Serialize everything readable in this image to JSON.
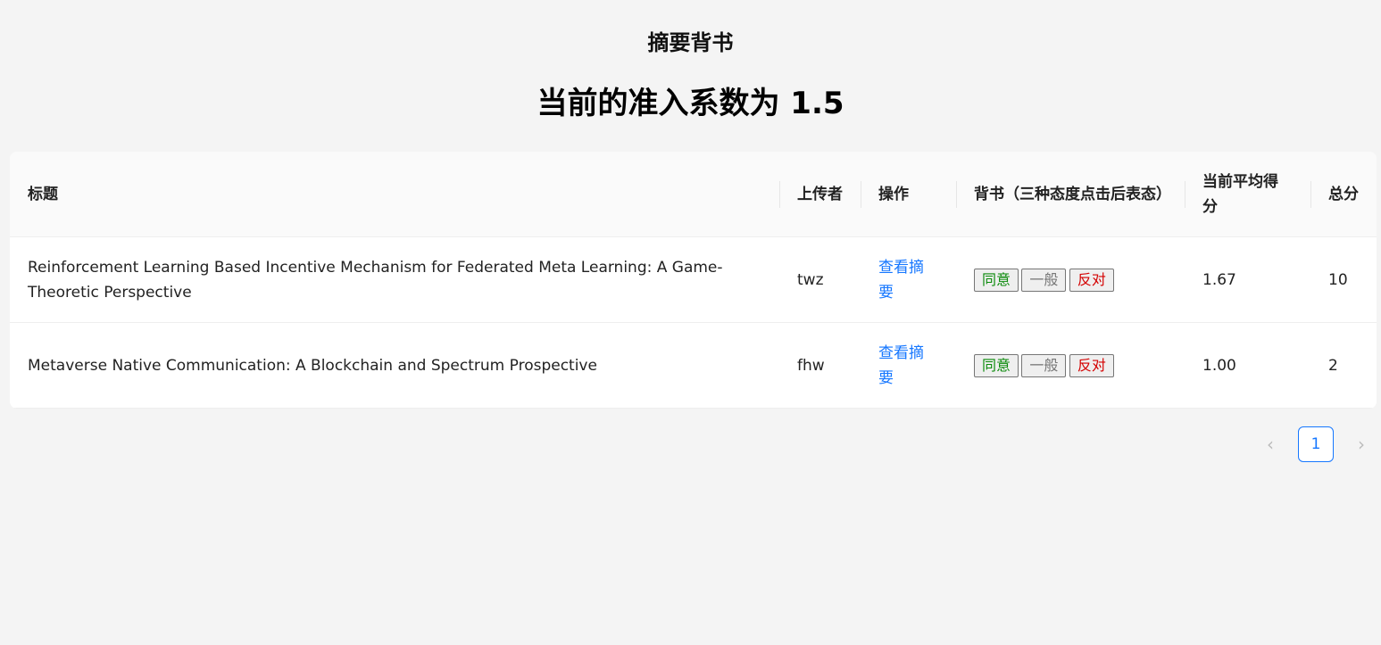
{
  "header": {
    "subtitle": "摘要背书",
    "title": "当前的准入系数为 1.5"
  },
  "table": {
    "columns": [
      "标题",
      "上传者",
      "操作",
      "背书（三种态度点击后表态）",
      "当前平均得分",
      "总分"
    ],
    "rows": [
      {
        "title": "Reinforcement Learning Based Incentive Mechanism for Federated Meta Learning: A Game-Theoretic Perspective",
        "uploader": "twz",
        "action": "查看摘要",
        "agree": "同意",
        "neutral": "一般",
        "oppose": "反对",
        "avg_score": "1.67",
        "total": "10"
      },
      {
        "title": "Metaverse Native Communication: A Blockchain and Spectrum Prospective",
        "uploader": "fhw",
        "action": "查看摘要",
        "agree": "同意",
        "neutral": "一般",
        "oppose": "反对",
        "avg_score": "1.00",
        "total": "2"
      }
    ]
  },
  "pagination": {
    "prev_icon": "‹",
    "current_page": "1",
    "next_icon": "›"
  },
  "colors": {
    "accent": "#1677ff",
    "agree": "#0a8a0a",
    "neutral": "#777777",
    "oppose": "#d40000"
  }
}
